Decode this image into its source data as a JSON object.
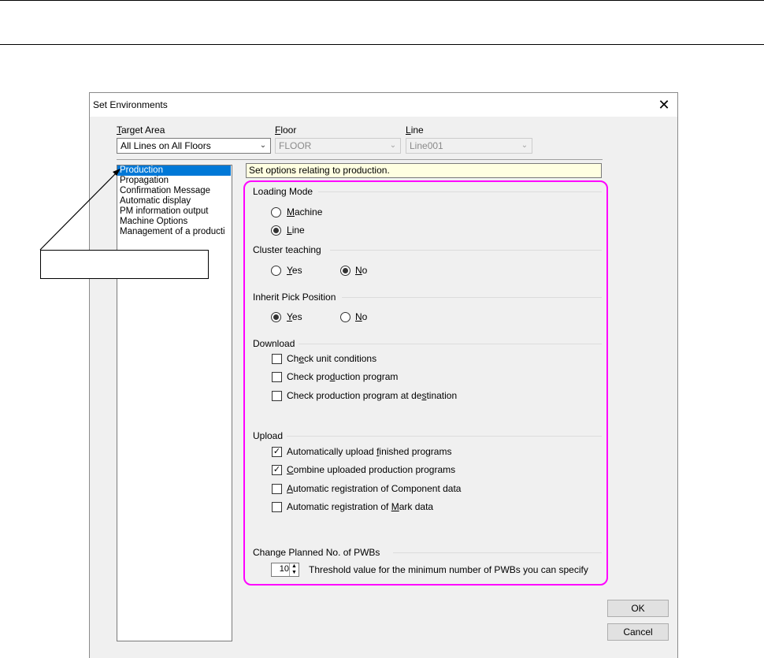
{
  "dialog": {
    "title": "Set Environments",
    "close_glyph": "✕"
  },
  "target": {
    "target_area_label": "Target Area",
    "target_area_value": "All Lines on All Floors",
    "floor_label": "Floor",
    "floor_value": "FLOOR",
    "line_label": "Line",
    "line_value": "Line001"
  },
  "sidebar": {
    "items": [
      {
        "label": "Production",
        "selected": true
      },
      {
        "label": "Propagation",
        "selected": false
      },
      {
        "label": "Confirmation Message",
        "selected": false
      },
      {
        "label": "Automatic display",
        "selected": false
      },
      {
        "label": "PM information output",
        "selected": false
      },
      {
        "label": "Machine Options",
        "selected": false
      },
      {
        "label": "Management of a producti",
        "selected": false
      }
    ]
  },
  "info": {
    "text": "Set options relating to production."
  },
  "loading_mode": {
    "title": "Loading Mode",
    "machine": "Machine",
    "line": "Line",
    "selected": "line"
  },
  "cluster_teaching": {
    "title": "Cluster teaching",
    "yes": "Yes",
    "no": "No",
    "selected": "no"
  },
  "inherit_pick": {
    "title": "Inherit Pick Position",
    "yes": "Yes",
    "no": "No",
    "selected": "yes"
  },
  "download": {
    "title": "Download",
    "check_unit": "Check unit conditions",
    "check_program": "Check production program",
    "check_destination": "Check production program at destination"
  },
  "upload": {
    "title": "Upload",
    "auto_upload": "Automatically upload finished programs",
    "combine": "Combine uploaded production programs",
    "reg_component": "Automatic registration of Component data",
    "reg_mark": "Automatic registration of Mark data"
  },
  "planned": {
    "title": "Change Planned No. of PWBs",
    "value": "10",
    "description": "Threshold value for the minimum number of PWBs you can specify"
  },
  "buttons": {
    "ok": "OK",
    "cancel": "Cancel"
  },
  "colors": {
    "highlight": "#ff00ff",
    "selection": "#0078d7",
    "info_bg": "#ffffe1"
  }
}
